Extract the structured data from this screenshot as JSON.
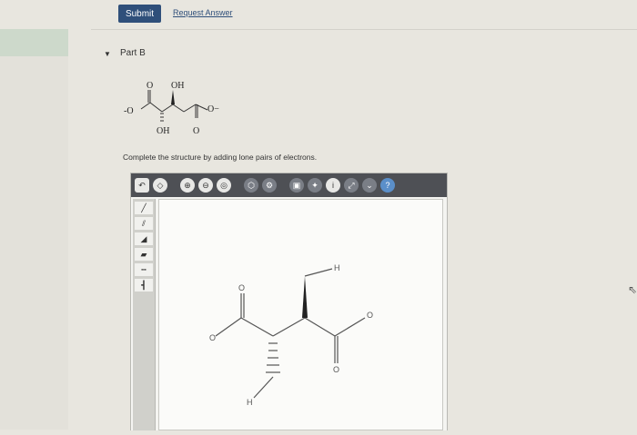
{
  "actions": {
    "submit_label": "Submit",
    "request_answer_label": "Request Answer"
  },
  "part": {
    "label": "Part B"
  },
  "question_molecule": {
    "labels": {
      "o_top_left": "O",
      "oh_top": "OH",
      "o_minus_left": "-O",
      "o_minus_right": "O−",
      "oh_bottom": "OH",
      "o_bottom": "O"
    }
  },
  "instructions": "Complete the structure by adding lone pairs of electrons.",
  "editor": {
    "toolbar_icons": [
      "undo-icon",
      "eraser-icon",
      "zoom-in-icon",
      "zoom-out-icon",
      "zoom-fit-icon",
      "template-icon",
      "settings-icon",
      "image-icon",
      "lightbulb-icon",
      "info-icon",
      "expand-icon",
      "dropdown-icon",
      "help-icon"
    ],
    "info_glyph": "i",
    "help_glyph": "?",
    "side_tools": [
      "single-bond",
      "double-bond",
      "wedge-bond",
      "bold-bond",
      "dash-bond",
      "bracket-bond"
    ],
    "molecule_labels": {
      "o_left": "O",
      "o_top": "O",
      "h_top": "H",
      "o_right": "O",
      "o_bottom": "O",
      "h_bottom": "H"
    }
  }
}
